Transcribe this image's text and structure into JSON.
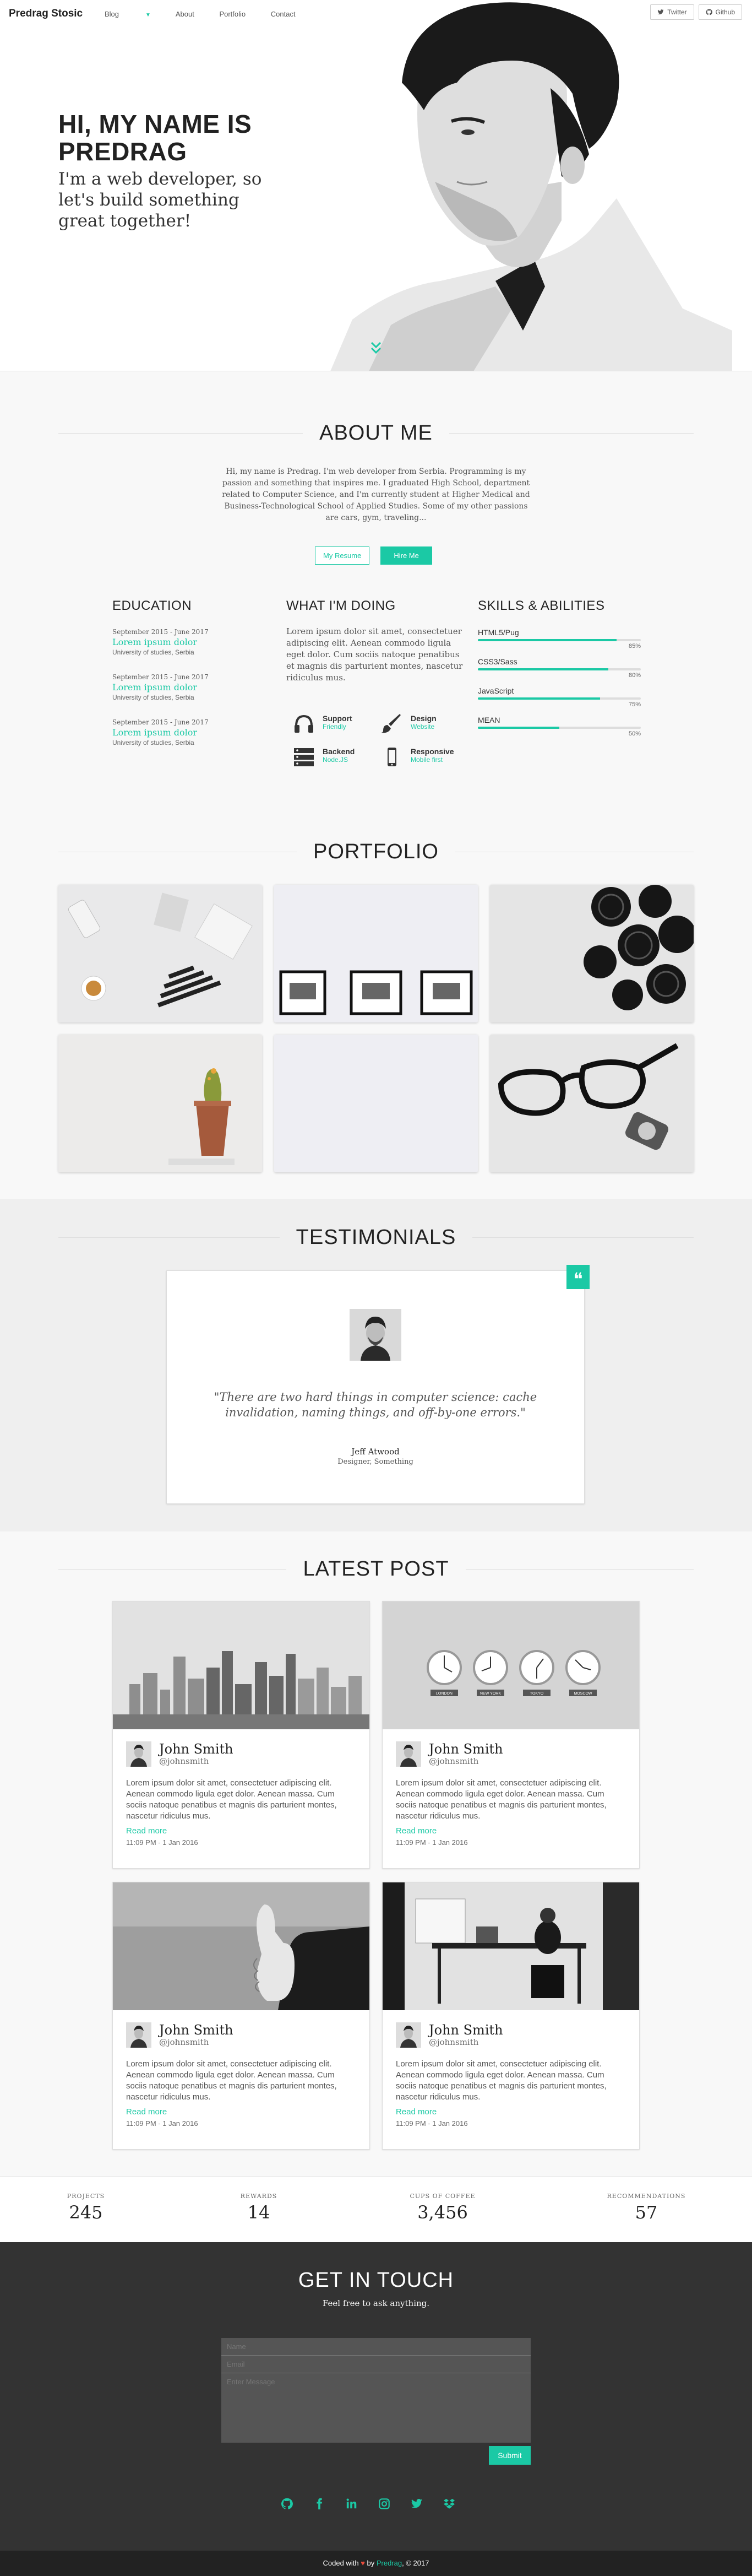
{
  "nav": {
    "brand": "Predrag Stosic",
    "links": [
      "Blog",
      "About",
      "Portfolio",
      "Contact"
    ],
    "twitter_label": "Twitter",
    "github_label": "Github"
  },
  "hero": {
    "title": "HI, MY NAME IS PREDRAG",
    "subtitle": "I'm a web developer, so let's build something great together!"
  },
  "about": {
    "title": "ABOUT ME",
    "text": "Hi, my name is Predrag. I'm web developer from Serbia. Programming is my passion and something that inspires me. I graduated High School, department related to Computer Science, and I'm currently student at Higher Medical and Business-Technological School of Applied Studies. Some of my other passions are cars, gym, traveling...",
    "resume_label": "My Resume",
    "hire_label": "Hire Me"
  },
  "education": {
    "title": "EDUCATION",
    "items": [
      {
        "date": "September 2015 - June 2017",
        "title": "Lorem ipsum dolor",
        "school": "University of studies, Serbia"
      },
      {
        "date": "September 2015 - June 2017",
        "title": "Lorem ipsum dolor",
        "school": "University of studies, Serbia"
      },
      {
        "date": "September 2015 - June 2017",
        "title": "Lorem ipsum dolor",
        "school": "University of studies, Serbia"
      }
    ]
  },
  "doing": {
    "title": "WHAT I'M DOING",
    "text": "Lorem ipsum dolor sit amet, consectetuer adipiscing elit. Aenean commodo ligula eget dolor. Cum sociis natoque penatibus et magnis dis parturient montes, nascetur ridiculus mus.",
    "features": [
      {
        "title": "Support",
        "sub": "Friendly",
        "icon": "headphones-icon"
      },
      {
        "title": "Design",
        "sub": "Website",
        "icon": "paint-brush-icon"
      },
      {
        "title": "Backend",
        "sub": "Node.JS",
        "icon": "server-icon"
      },
      {
        "title": "Responsive",
        "sub": "Mobile first",
        "icon": "mobile-icon"
      }
    ]
  },
  "skills": {
    "title": "SKILLS & ABILITIES",
    "items": [
      {
        "name": "HTML5/Pug",
        "pct": "85%",
        "value": 85
      },
      {
        "name": "CSS3/Sass",
        "pct": "80%",
        "value": 80
      },
      {
        "name": "JavaScript",
        "pct": "75%",
        "value": 75
      },
      {
        "name": "MEAN",
        "pct": "50%",
        "value": 50
      }
    ]
  },
  "portfolio": {
    "title": "PORTFOLIO"
  },
  "testimonials": {
    "title": "TESTIMONIALS",
    "quote": "\"There are two hard things in computer science: cache invalidation, naming things, and off-by-one errors.\"",
    "name": "Jeff Atwood",
    "role": "Designer, Something"
  },
  "posts": {
    "title": "LATEST POST",
    "items": [
      {
        "name": "John Smith",
        "handle": "@johnsmith",
        "body": "Lorem ipsum dolor sit amet, consectetuer adipiscing elit. Aenean commodo ligula eget dolor. Aenean massa. Cum sociis natoque penatibus et magnis dis parturient montes, nascetur ridiculus mus.",
        "more": "Read more",
        "date": "11:09 PM - 1 Jan 2016"
      },
      {
        "name": "John Smith",
        "handle": "@johnsmith",
        "body": "Lorem ipsum dolor sit amet, consectetuer adipiscing elit. Aenean commodo ligula eget dolor. Aenean massa. Cum sociis natoque penatibus et magnis dis parturient montes, nascetur ridiculus mus.",
        "more": "Read more",
        "date": "11:09 PM - 1 Jan 2016"
      },
      {
        "name": "John Smith",
        "handle": "@johnsmith",
        "body": "Lorem ipsum dolor sit amet, consectetuer adipiscing elit. Aenean commodo ligula eget dolor. Aenean massa. Cum sociis natoque penatibus et magnis dis parturient montes, nascetur ridiculus mus.",
        "more": "Read more",
        "date": "11:09 PM - 1 Jan 2016"
      },
      {
        "name": "John Smith",
        "handle": "@johnsmith",
        "body": "Lorem ipsum dolor sit amet, consectetuer adipiscing elit. Aenean commodo ligula eget dolor. Aenean massa. Cum sociis natoque penatibus et magnis dis parturient montes, nascetur ridiculus mus.",
        "more": "Read more",
        "date": "11:09 PM - 1 Jan 2016"
      }
    ],
    "clock_labels": [
      "LONDON",
      "NEW YORK",
      "TOKYO",
      "MOSCOW"
    ]
  },
  "stats": [
    {
      "label": "PROJECTS",
      "value": "245"
    },
    {
      "label": "REWARDS",
      "value": "14"
    },
    {
      "label": "CUPS OF COFFEE",
      "value": "3,456"
    },
    {
      "label": "RECOMMENDATIONS",
      "value": "57"
    }
  ],
  "contact": {
    "title": "GET IN TOUCH",
    "subtitle": "Feel free to ask anything.",
    "name_placeholder": "Name",
    "email_placeholder": "Email",
    "message_placeholder": "Enter Message",
    "submit_label": "Submit"
  },
  "socials": [
    "github-icon",
    "facebook-icon",
    "linkedin-icon",
    "instagram-icon",
    "twitter-icon",
    "dropbox-icon"
  ],
  "footer": {
    "prefix": "Coded with",
    "by": "by",
    "author": "Predrag",
    "suffix": ", © 2017"
  },
  "colors": {
    "accent": "#1bc9a5",
    "dark": "#333333",
    "footer": "#222222"
  }
}
